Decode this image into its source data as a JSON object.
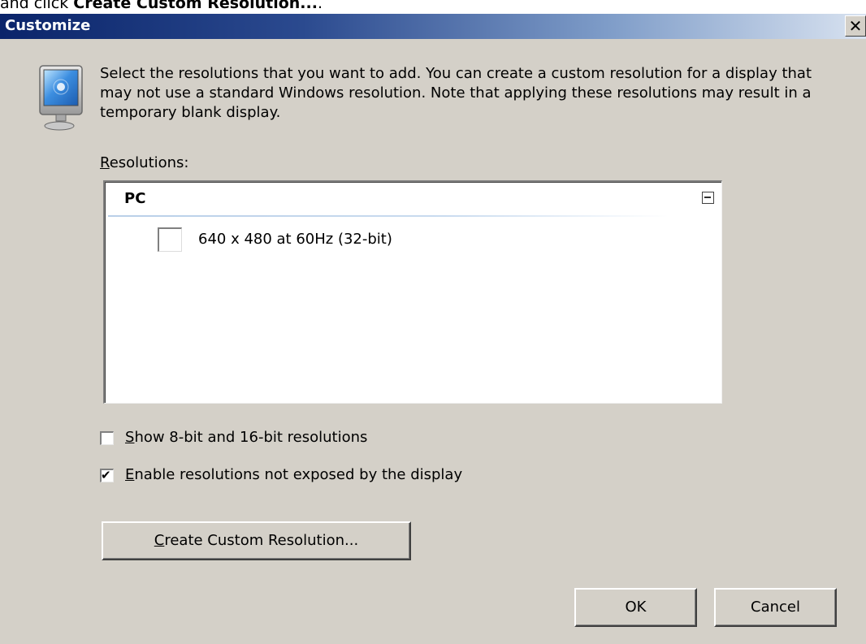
{
  "caption": {
    "prefix": "and click ",
    "bold": "Create Custom Resolution...",
    "suffix": "."
  },
  "dialog": {
    "title": "Customize",
    "close_glyph": "✕",
    "description": "Select the resolutions that you want to add. You can create a custom resolution for a display that may not use a standard Windows resolution. Note that applying these resolutions may result in a temporary blank display.",
    "resolutions_label": {
      "accel": "R",
      "rest": "esolutions:"
    },
    "list": {
      "group": "PC",
      "items": [
        {
          "label": "640 x 480 at 60Hz (32-bit)",
          "checked": false
        }
      ]
    },
    "options": [
      {
        "accel": "S",
        "rest": "how 8-bit and 16-bit resolutions",
        "checked": false
      },
      {
        "accel": "E",
        "rest": "nable resolutions not exposed by the display",
        "checked": true
      }
    ],
    "buttons": {
      "create": {
        "accel": "C",
        "rest": "reate Custom Resolution..."
      },
      "ok": "OK",
      "cancel": "Cancel"
    },
    "icons": {
      "monitor": "monitor-icon",
      "collapse": "collapse-icon",
      "check": "✔"
    }
  }
}
